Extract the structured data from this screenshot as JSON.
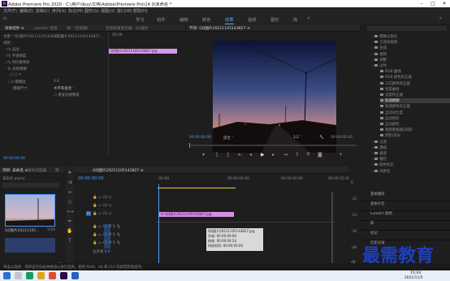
{
  "titlebar": {
    "text": "Adobe Premiere Pro 2020 - C:\\用户\\lbuy\\文档\\Adobe\\Premiere Pro\\14.0\\未命名 *",
    "min": "–",
    "max": "□",
    "close": "✕"
  },
  "menu": [
    "文件(F)",
    "编辑(E)",
    "剪辑(C)",
    "序列(S)",
    "标记(M)",
    "图形(G)",
    "视图(V)",
    "窗口(W)",
    "帮助(H)"
  ],
  "workspaces": [
    "学习",
    "组件",
    "编辑",
    "颜色",
    "效果",
    "音频",
    "图形",
    "库"
  ],
  "effect_controls": {
    "tabs": [
      "效果控件 ≡",
      "Lumetri 范围",
      "源：(无剪辑)",
      "音频剪辑混合器：QQ图片"
    ],
    "source": "主要 * QQ图片20211105143827...",
    "seq": "QQ图片20211105143827...",
    "clip_tc": "00:00",
    "clip_name": "QQ图片20211105143827.jpg",
    "section_video": "视频",
    "rows": [
      "运动",
      "不透明度",
      "时间重映射",
      "高斯模糊"
    ],
    "blur_label": "模糊度",
    "blur_value": "0.0",
    "dim_label": "模糊尺寸",
    "dim_value": "水平和垂直",
    "repeat_label": "重复边缘像素",
    "timecode": "00:00:00:00"
  },
  "program": {
    "title": "节目: QQ图片20211105143827 ≡",
    "tc_left": "00:00:00:00",
    "fit": "适合",
    "ratio": "1/2",
    "tc_right": "00:00:05:00"
  },
  "project": {
    "tabs": [
      "项目: 未命名 ≡",
      "媒体浏览器",
      "库"
    ],
    "file": "未命名.prproj",
    "item_name": "QQ图片20211105...",
    "item_dur": "5:00"
  },
  "timeline": {
    "tab": "QQ图片20211105143827 ≡",
    "tc": "00:00:00:00",
    "ruler": [
      ":00:00",
      "00:00:05:00",
      "00:00:10:00",
      "00:00:15:00"
    ],
    "video_tracks": [
      "V3",
      "V2",
      "V1"
    ],
    "audio_tracks": [
      "A1",
      "A2",
      "A3"
    ],
    "master": "主声道",
    "master_val": "0.0",
    "clip": "QQ图片20211105143827.jpg",
    "tooltip": {
      "name": "QQ图片20211105143827.jpg",
      "start": "开始: 00:00:00:00",
      "end": "结束: 00:00:04:24",
      "dur": "持续时间: 00:00:05:00"
    },
    "meter_scale": [
      "0",
      "-12",
      "-24",
      "-36",
      "-48",
      "dB"
    ]
  },
  "effects": {
    "tree": [
      "模糊与锐化",
      "沉浸式视频",
      "生成",
      "视频",
      "调整",
      "过时"
    ],
    "subitems": [
      "RGB 曲线",
      "RGB 颜色校正器",
      "三向颜色校正器",
      "亮度曲线",
      "亮度校正器",
      "快速模糊",
      "快速颜色校正器",
      "自动对比度",
      "自动色阶",
      "自动颜色",
      "视频限幅器(旧版)",
      "阴影/高光"
    ],
    "after": [
      "过渡",
      "透视",
      "通道",
      "键控",
      "颜色校正",
      "风格化"
    ],
    "panels": [
      "基本图形",
      "基本声音",
      "Lumetri 颜色",
      "库",
      "标记",
      "历史记录"
    ]
  },
  "status": {
    "text": "单击以选择，或单击空白处并拖动以进行选择。使用 Shift、Alt 和 Ctrl 可获得其他选项。"
  },
  "watermark": "最需教育",
  "taskbar": {
    "time": "15:04",
    "date": "2021/11/5"
  }
}
